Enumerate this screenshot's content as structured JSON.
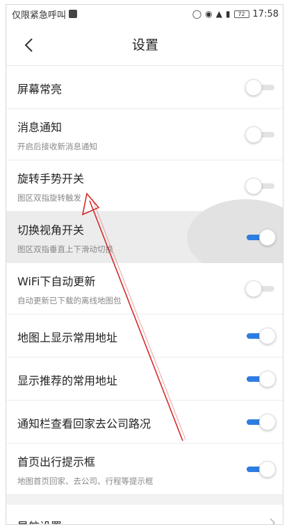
{
  "status_bar": {
    "carrier_text": "仅限紧急呼叫",
    "battery": "72",
    "time": "17:58"
  },
  "header": {
    "title": "设置"
  },
  "settings": [
    {
      "title": "屏幕常亮",
      "subtitle": "",
      "on": false
    },
    {
      "title": "消息通知",
      "subtitle": "开启后接收新消息通知",
      "on": false
    },
    {
      "title": "旋转手势开关",
      "subtitle": "图区双指旋转触发",
      "on": false
    },
    {
      "title": "切换视角开关",
      "subtitle": "图区双指垂直上下滑动切换",
      "on": true
    },
    {
      "title": "WiFi下自动更新",
      "subtitle": "自动更新已下载的离线地图包",
      "on": false
    },
    {
      "title": "地图上显示常用地址",
      "subtitle": "",
      "on": true
    },
    {
      "title": "显示推荐的常用地址",
      "subtitle": "",
      "on": true
    },
    {
      "title": "通知栏查看回家去公司路况",
      "subtitle": "",
      "on": true
    },
    {
      "title": "首页出行提示框",
      "subtitle": "地图首页回家、去公司、行程等提示框",
      "on": true
    }
  ],
  "nav_row": {
    "title": "导航设置"
  },
  "colors": {
    "toggle_on": "#2f7de1",
    "toggle_off": "#e3e3e3",
    "annotation_arrow": "#d22a2a"
  }
}
